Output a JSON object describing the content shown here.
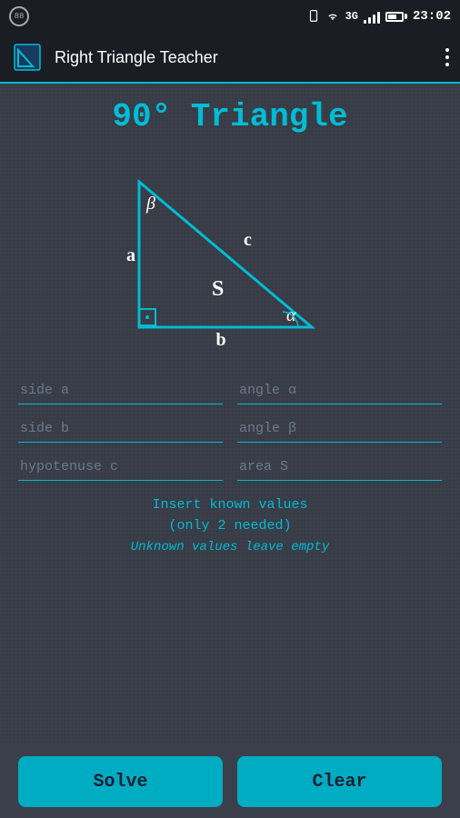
{
  "statusBar": {
    "appBadge": "88",
    "network": "3G",
    "time": "23:02"
  },
  "appBar": {
    "title": "Right Triangle Teacher",
    "menuLabel": "more options"
  },
  "main": {
    "heading": "90°  Triangle",
    "triangle": {
      "labelA": "a",
      "labelB": "b",
      "labelC": "c",
      "labelAlpha": "α",
      "labelBeta": "β",
      "labelS": "S"
    },
    "fields": [
      {
        "id": "side-a",
        "placeholder": "side a"
      },
      {
        "id": "angle-alpha",
        "placeholder": "angle α"
      },
      {
        "id": "side-b",
        "placeholder": "side b"
      },
      {
        "id": "angle-beta",
        "placeholder": "angle β"
      },
      {
        "id": "hypotenuse-c",
        "placeholder": "hypotenuse c"
      },
      {
        "id": "area-s",
        "placeholder": "area S"
      }
    ],
    "instructions": {
      "line1": "Insert known values",
      "line2": "(only 2 needed)",
      "line3": "Unknown values leave empty"
    },
    "buttons": {
      "solve": "Solve",
      "clear": "Clear"
    }
  }
}
